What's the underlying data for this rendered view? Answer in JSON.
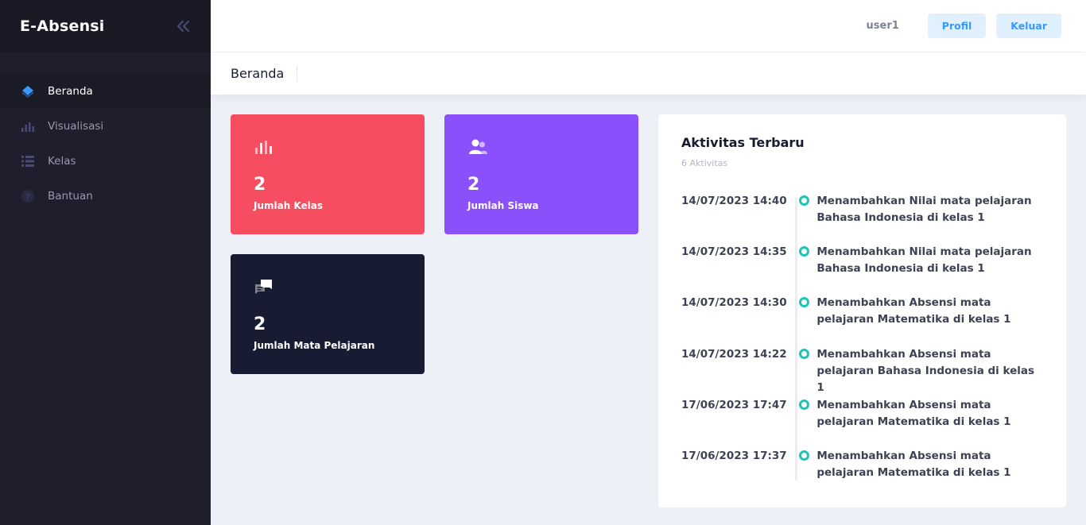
{
  "app": {
    "title": "E-Absensi"
  },
  "sidebar": {
    "items": [
      {
        "label": "Beranda",
        "icon": "diamond-layers-icon",
        "active": true
      },
      {
        "label": "Visualisasi",
        "icon": "bar-chart-icon",
        "active": false
      },
      {
        "label": "Kelas",
        "icon": "list-icon",
        "active": false
      },
      {
        "label": "Bantuan",
        "icon": "question-circle-icon",
        "active": false
      }
    ]
  },
  "header": {
    "username": "user1",
    "profile_label": "Profil",
    "logout_label": "Keluar"
  },
  "subheader": {
    "title": "Beranda"
  },
  "stats": [
    {
      "value": "2",
      "label": "Jumlah Kelas",
      "color": "#f64e60",
      "icon": "bar-chart-icon"
    },
    {
      "value": "2",
      "label": "Jumlah Siswa",
      "color": "#8950fc",
      "icon": "users-icon"
    },
    {
      "value": "2",
      "label": "Jumlah Mata Pelajaran",
      "color": "#181c32",
      "icon": "chat-bubbles-icon"
    }
  ],
  "activity": {
    "title": "Aktivitas Terbaru",
    "subtitle": "6 Aktivitas",
    "items": [
      {
        "time": "14/07/2023 14:40",
        "text": "Menambahkan Nilai mata pelajaran Bahasa Indonesia di kelas 1"
      },
      {
        "time": "14/07/2023 14:35",
        "text": "Menambahkan Nilai mata pelajaran Bahasa Indonesia di kelas 1"
      },
      {
        "time": "14/07/2023 14:30",
        "text": "Menambahkan Absensi mata pelajaran Matematika di kelas 1"
      },
      {
        "time": "14/07/2023 14:22",
        "text": "Menambahkan Absensi mata pelajaran Bahasa Indonesia di kelas 1"
      },
      {
        "time": "17/06/2023 17:47",
        "text": "Menambahkan Absensi mata pelajaran Matematika di kelas 1"
      },
      {
        "time": "17/06/2023 17:37",
        "text": "Menambahkan Absensi mata pelajaran Matematika di kelas 1"
      }
    ]
  },
  "colors": {
    "accent": "#3699ff",
    "timeline_dot": "#1bc5bd",
    "sidebar_bg": "#1e1e2d"
  }
}
